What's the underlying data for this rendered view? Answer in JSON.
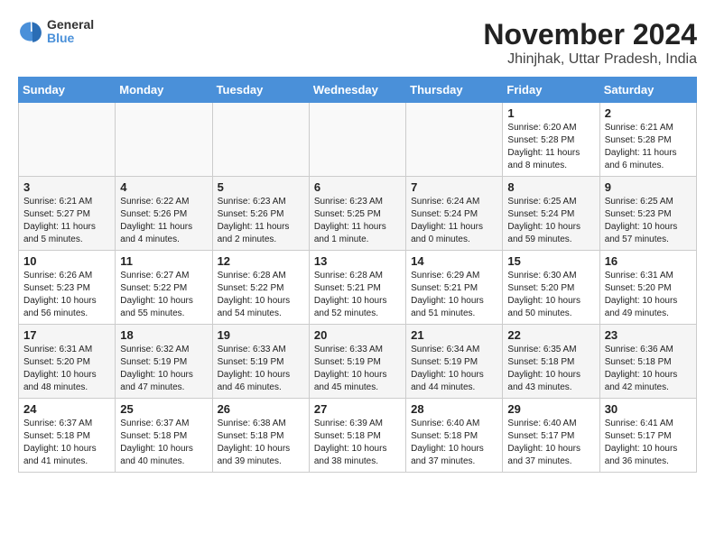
{
  "header": {
    "logo_general": "General",
    "logo_blue": "Blue",
    "month": "November 2024",
    "location": "Jhinjhak, Uttar Pradesh, India"
  },
  "weekdays": [
    "Sunday",
    "Monday",
    "Tuesday",
    "Wednesday",
    "Thursday",
    "Friday",
    "Saturday"
  ],
  "weeks": [
    [
      {
        "day": "",
        "info": ""
      },
      {
        "day": "",
        "info": ""
      },
      {
        "day": "",
        "info": ""
      },
      {
        "day": "",
        "info": ""
      },
      {
        "day": "",
        "info": ""
      },
      {
        "day": "1",
        "info": "Sunrise: 6:20 AM\nSunset: 5:28 PM\nDaylight: 11 hours\nand 8 minutes."
      },
      {
        "day": "2",
        "info": "Sunrise: 6:21 AM\nSunset: 5:28 PM\nDaylight: 11 hours\nand 6 minutes."
      }
    ],
    [
      {
        "day": "3",
        "info": "Sunrise: 6:21 AM\nSunset: 5:27 PM\nDaylight: 11 hours\nand 5 minutes."
      },
      {
        "day": "4",
        "info": "Sunrise: 6:22 AM\nSunset: 5:26 PM\nDaylight: 11 hours\nand 4 minutes."
      },
      {
        "day": "5",
        "info": "Sunrise: 6:23 AM\nSunset: 5:26 PM\nDaylight: 11 hours\nand 2 minutes."
      },
      {
        "day": "6",
        "info": "Sunrise: 6:23 AM\nSunset: 5:25 PM\nDaylight: 11 hours\nand 1 minute."
      },
      {
        "day": "7",
        "info": "Sunrise: 6:24 AM\nSunset: 5:24 PM\nDaylight: 11 hours\nand 0 minutes."
      },
      {
        "day": "8",
        "info": "Sunrise: 6:25 AM\nSunset: 5:24 PM\nDaylight: 10 hours\nand 59 minutes."
      },
      {
        "day": "9",
        "info": "Sunrise: 6:25 AM\nSunset: 5:23 PM\nDaylight: 10 hours\nand 57 minutes."
      }
    ],
    [
      {
        "day": "10",
        "info": "Sunrise: 6:26 AM\nSunset: 5:23 PM\nDaylight: 10 hours\nand 56 minutes."
      },
      {
        "day": "11",
        "info": "Sunrise: 6:27 AM\nSunset: 5:22 PM\nDaylight: 10 hours\nand 55 minutes."
      },
      {
        "day": "12",
        "info": "Sunrise: 6:28 AM\nSunset: 5:22 PM\nDaylight: 10 hours\nand 54 minutes."
      },
      {
        "day": "13",
        "info": "Sunrise: 6:28 AM\nSunset: 5:21 PM\nDaylight: 10 hours\nand 52 minutes."
      },
      {
        "day": "14",
        "info": "Sunrise: 6:29 AM\nSunset: 5:21 PM\nDaylight: 10 hours\nand 51 minutes."
      },
      {
        "day": "15",
        "info": "Sunrise: 6:30 AM\nSunset: 5:20 PM\nDaylight: 10 hours\nand 50 minutes."
      },
      {
        "day": "16",
        "info": "Sunrise: 6:31 AM\nSunset: 5:20 PM\nDaylight: 10 hours\nand 49 minutes."
      }
    ],
    [
      {
        "day": "17",
        "info": "Sunrise: 6:31 AM\nSunset: 5:20 PM\nDaylight: 10 hours\nand 48 minutes."
      },
      {
        "day": "18",
        "info": "Sunrise: 6:32 AM\nSunset: 5:19 PM\nDaylight: 10 hours\nand 47 minutes."
      },
      {
        "day": "19",
        "info": "Sunrise: 6:33 AM\nSunset: 5:19 PM\nDaylight: 10 hours\nand 46 minutes."
      },
      {
        "day": "20",
        "info": "Sunrise: 6:33 AM\nSunset: 5:19 PM\nDaylight: 10 hours\nand 45 minutes."
      },
      {
        "day": "21",
        "info": "Sunrise: 6:34 AM\nSunset: 5:19 PM\nDaylight: 10 hours\nand 44 minutes."
      },
      {
        "day": "22",
        "info": "Sunrise: 6:35 AM\nSunset: 5:18 PM\nDaylight: 10 hours\nand 43 minutes."
      },
      {
        "day": "23",
        "info": "Sunrise: 6:36 AM\nSunset: 5:18 PM\nDaylight: 10 hours\nand 42 minutes."
      }
    ],
    [
      {
        "day": "24",
        "info": "Sunrise: 6:37 AM\nSunset: 5:18 PM\nDaylight: 10 hours\nand 41 minutes."
      },
      {
        "day": "25",
        "info": "Sunrise: 6:37 AM\nSunset: 5:18 PM\nDaylight: 10 hours\nand 40 minutes."
      },
      {
        "day": "26",
        "info": "Sunrise: 6:38 AM\nSunset: 5:18 PM\nDaylight: 10 hours\nand 39 minutes."
      },
      {
        "day": "27",
        "info": "Sunrise: 6:39 AM\nSunset: 5:18 PM\nDaylight: 10 hours\nand 38 minutes."
      },
      {
        "day": "28",
        "info": "Sunrise: 6:40 AM\nSunset: 5:18 PM\nDaylight: 10 hours\nand 37 minutes."
      },
      {
        "day": "29",
        "info": "Sunrise: 6:40 AM\nSunset: 5:17 PM\nDaylight: 10 hours\nand 37 minutes."
      },
      {
        "day": "30",
        "info": "Sunrise: 6:41 AM\nSunset: 5:17 PM\nDaylight: 10 hours\nand 36 minutes."
      }
    ]
  ]
}
